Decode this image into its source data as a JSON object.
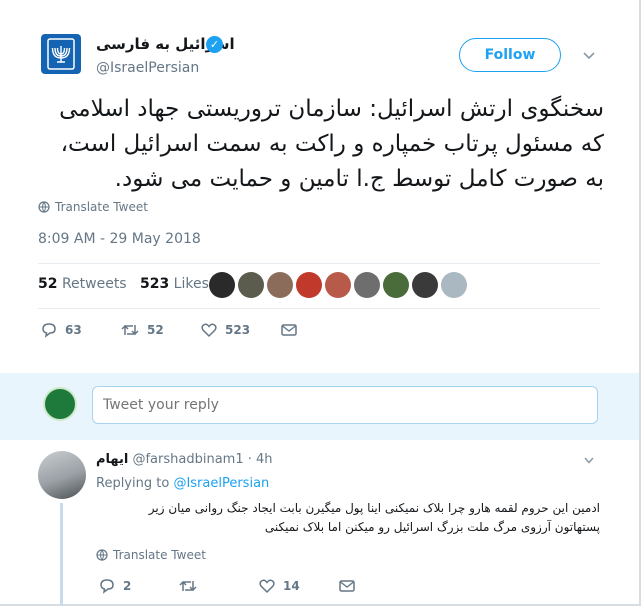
{
  "author": {
    "name": "اسرائیل به فارسی",
    "handle": "@IsraelPersian",
    "follow_label": "Follow"
  },
  "tweet": {
    "text": "سخنگوی ارتش اسرائیل: سازمان تروریستی جهاد اسلامی که مسئول پرتاب خمپاره و راکت به سمت اسرائیل است، به صورت کامل توسط ج.ا تامین و حمایت می شود.",
    "translate_label": "Translate Tweet",
    "timestamp": "8:09 AM - 29 May 2018",
    "retweets_count": "52",
    "retweets_label": "Retweets",
    "likes_count": "523",
    "likes_label": "Likes",
    "reply_count": "63",
    "retweet_count": "52",
    "like_count": "523"
  },
  "liker_colors": [
    "#2a2a2a",
    "#5c5c4e",
    "#8b6b5a",
    "#c0392b",
    "#b85a4a",
    "#6e6e6e",
    "#4a6b3a",
    "#3a3a3a",
    "#aab8c2"
  ],
  "compose": {
    "placeholder": "Tweet your reply"
  },
  "reply": {
    "name": "ایهام",
    "handle": "@farshadbinam1",
    "time": "· 4h",
    "replying_prefix": "Replying to",
    "replying_handle": "@IsraelPersian",
    "text": "ادمین این حروم لقمه هارو چرا بلاک نمیکنی اینا پول میگیرن بابت ایجاد جنگ روانی میان زیر پستهاتون آرزوی مرگ ملت بزرگ اسرائیل رو میکنن اما بلاک نمیکنی",
    "translate_label": "Translate Tweet",
    "reply_count": "2",
    "retweet_count": "",
    "like_count": "14"
  },
  "colors": {
    "accent": "#1da1f2",
    "muted": "#657786",
    "reply_band": "#e8f5fd"
  }
}
